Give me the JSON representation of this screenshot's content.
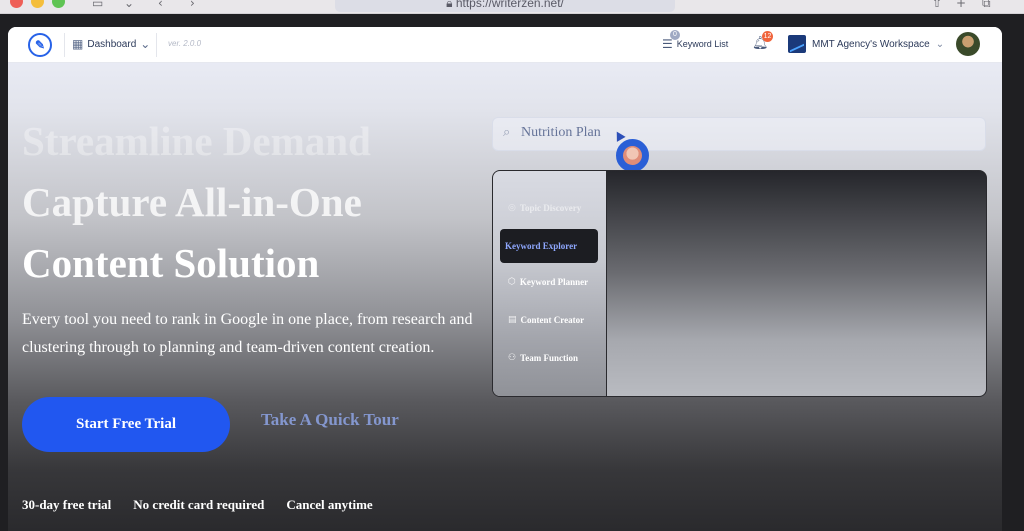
{
  "browser": {
    "url": "https://writerzen.net/",
    "icons": {
      "sidebar": "sidebar-toggle-icon",
      "back": "back-arrow-icon",
      "forward": "forward-arrow-icon",
      "share": "share-icon",
      "new_tab": "plus-icon",
      "tabs": "tabs-icon"
    }
  },
  "navbar": {
    "dashboard_label": "Dashboard",
    "version": "ver. 2.0.0",
    "keyword_list_label": "Keyword List",
    "keyword_list_badge": "0",
    "notification_badge": "12",
    "workspace_label": "MMT Agency's Workspace"
  },
  "hero": {
    "title_lines": [
      "Streamline Demand",
      "Capture All-in-One",
      "Content Solution"
    ],
    "description": "Every tool you need to rank in Google in one place, from research and clustering through to planning and team-driven content creation.",
    "cta_label": "Start Free Trial",
    "tour_label": "Take A Quick Tour",
    "features": [
      "30-day free trial",
      "No credit card required",
      "Cancel anytime"
    ]
  },
  "demo": {
    "search_value": "Nutrition Plan",
    "tools": [
      {
        "label": "Topic Discovery",
        "icon": "topic-icon"
      },
      {
        "label": "Keyword Explorer",
        "icon": "keyword-icon"
      },
      {
        "label": "Keyword Planner",
        "icon": "planner-icon"
      },
      {
        "label": "Content Creator",
        "icon": "content-icon"
      },
      {
        "label": "Team Function",
        "icon": "team-icon"
      }
    ],
    "active_tool": "Keyword Explorer"
  },
  "colors": {
    "accent": "#2157f0",
    "tour_link": "#8497cf",
    "badge_orange": "#f0643c"
  }
}
